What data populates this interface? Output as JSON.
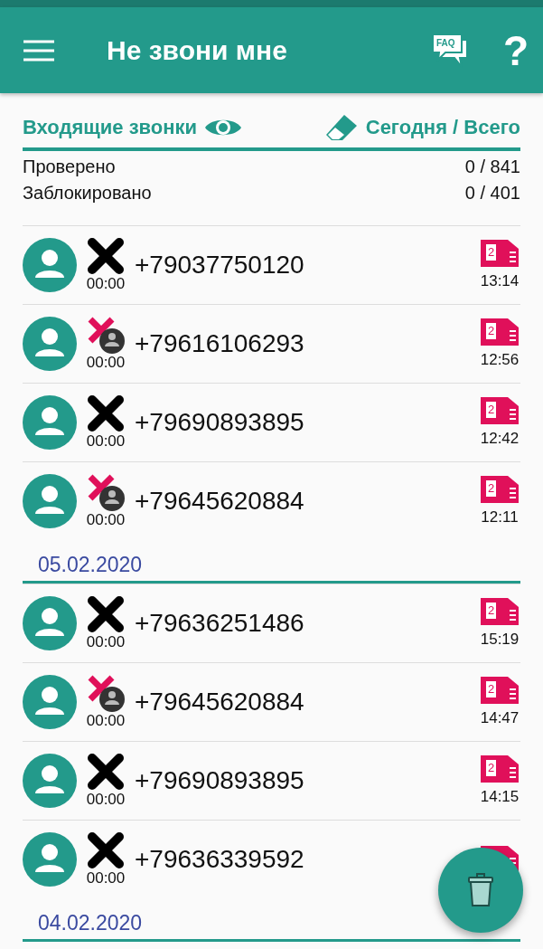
{
  "app_bar": {
    "title": "Не звони мне",
    "faq_label": "FAQ",
    "help_label": "?"
  },
  "summary": {
    "heading": "Входящие звонки",
    "period": "Сегодня / Всего",
    "stats": [
      {
        "label": "Проверено",
        "value": "0 / 841"
      },
      {
        "label": "Заблокировано",
        "value": "0 / 401"
      }
    ]
  },
  "groups": [
    {
      "calls": [
        {
          "number": "+79037750120",
          "duration": "00:00",
          "kind": "cross",
          "sim": "2",
          "time": "13:14"
        },
        {
          "number": "+79616106293",
          "duration": "00:00",
          "kind": "contact",
          "sim": "2",
          "time": "12:56"
        },
        {
          "number": "+79690893895",
          "duration": "00:00",
          "kind": "cross",
          "sim": "2",
          "time": "12:42"
        },
        {
          "number": "+79645620884",
          "duration": "00:00",
          "kind": "contact",
          "sim": "2",
          "time": "12:11"
        }
      ]
    },
    {
      "date": "05.02.2020",
      "calls": [
        {
          "number": "+79636251486",
          "duration": "00:00",
          "kind": "cross",
          "sim": "2",
          "time": "15:19"
        },
        {
          "number": "+79645620884",
          "duration": "00:00",
          "kind": "contact",
          "sim": "2",
          "time": "14:47"
        },
        {
          "number": "+79690893895",
          "duration": "00:00",
          "kind": "cross",
          "sim": "2",
          "time": "14:15"
        },
        {
          "number": "+79636339592",
          "duration": "00:00",
          "kind": "cross"
        }
      ]
    },
    {
      "date": "04.02.2020"
    }
  ]
}
